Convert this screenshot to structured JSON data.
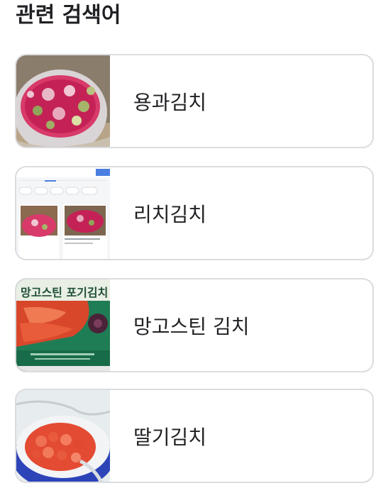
{
  "section": {
    "title": "관련 검색어"
  },
  "related_searches": [
    {
      "label": "용과김치",
      "thumbnail": "dragonfruit-kimchi-bowl-photo"
    },
    {
      "label": "리치김치",
      "thumbnail": "lychee-kimchi-search-screenshot"
    },
    {
      "label": "망고스틴 김치",
      "thumbnail": "mangosteen-kimchi-package-photo",
      "thumbnail_text": "망고스틴 포기김치"
    },
    {
      "label": "딸기김치",
      "thumbnail": "strawberry-kimchi-bowl-photo"
    }
  ],
  "colors": {
    "card_border": "#dadce0",
    "text": "#202124"
  }
}
